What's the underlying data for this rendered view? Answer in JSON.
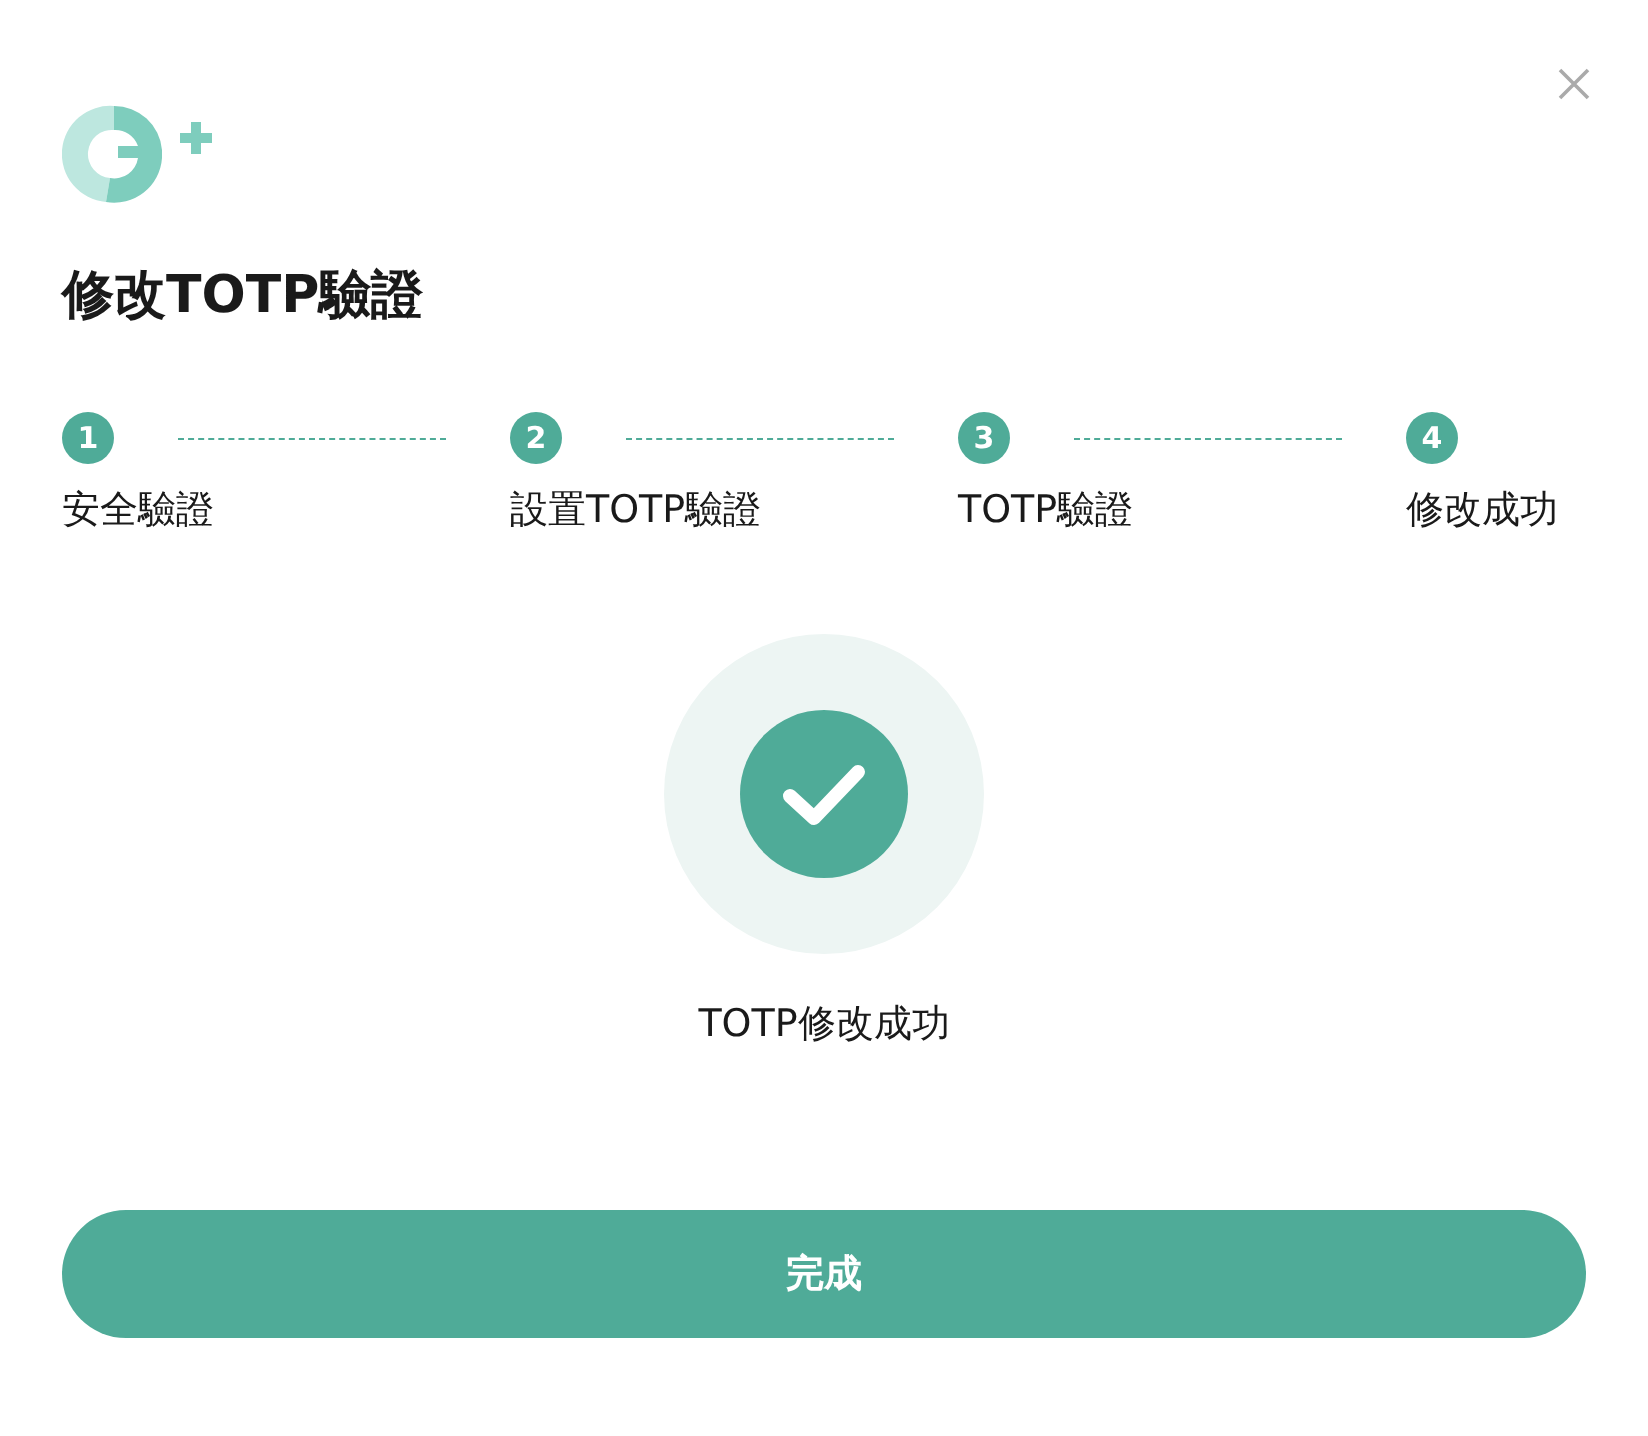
{
  "dialog": {
    "title": "修改TOTP驗證"
  },
  "steps": [
    {
      "number": "1",
      "label": "安全驗證",
      "done": true
    },
    {
      "number": "2",
      "label": "設置TOTP驗證",
      "done": true
    },
    {
      "number": "3",
      "label": "TOTP驗證",
      "done": true
    },
    {
      "number": "4",
      "label": "修改成功",
      "done": true
    }
  ],
  "result": {
    "message": "TOTP修改成功"
  },
  "button": {
    "label": "完成"
  }
}
